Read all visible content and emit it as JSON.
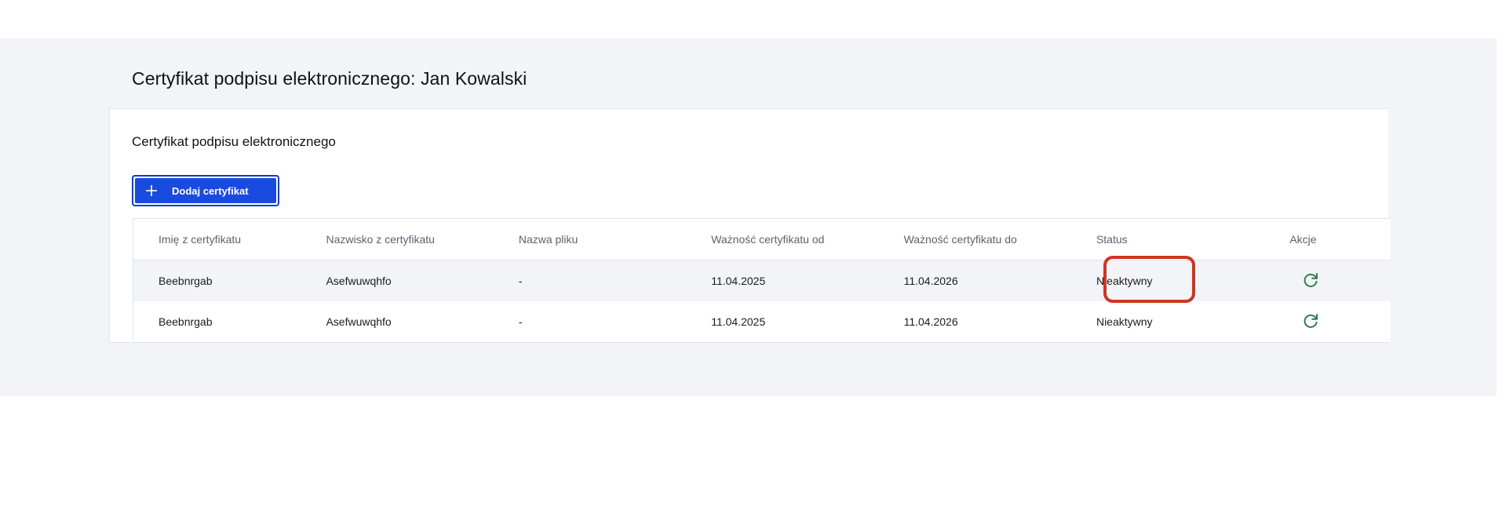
{
  "page": {
    "title": "Certyfikat podpisu elektronicznego: Jan Kowalski"
  },
  "card": {
    "title": "Certyfikat podpisu elektronicznego",
    "add_button_label": "Dodaj certyfikat"
  },
  "table": {
    "headers": {
      "first_name": "Imię z certyfikatu",
      "last_name": "Nazwisko z certyfikatu",
      "file_name": "Nazwa pliku",
      "valid_from": "Ważność certyfikatu od",
      "valid_to": "Ważność certyfikatu do",
      "status": "Status",
      "actions": "Akcje"
    },
    "rows": [
      {
        "first_name": "Beebnrgab",
        "last_name": "Asefwuwqhfo",
        "file_name": "-",
        "valid_from": "11.04.2025",
        "valid_to": "11.04.2026",
        "status": "Nieaktywny",
        "action_icon": "refresh-icon"
      },
      {
        "first_name": "Beebnrgab",
        "last_name": "Asefwuwqhfo",
        "file_name": "-",
        "valid_from": "11.04.2025",
        "valid_to": "11.04.2026",
        "status": "Nieaktywny",
        "action_icon": "refresh-icon"
      }
    ]
  },
  "colors": {
    "primary_button": "#1a4be0",
    "highlight": "#d0341f",
    "refresh_icon": "#2e7d4f",
    "band_background": "#f3f4f8"
  }
}
